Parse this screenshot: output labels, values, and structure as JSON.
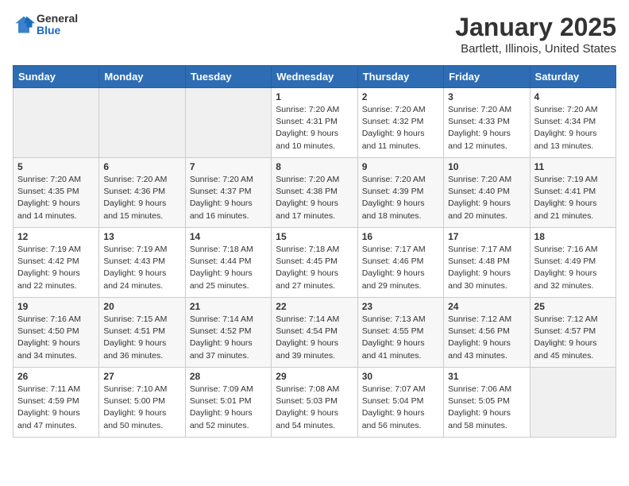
{
  "header": {
    "logo": {
      "general": "General",
      "blue": "Blue"
    },
    "title": "January 2025",
    "subtitle": "Bartlett, Illinois, United States"
  },
  "weekdays": [
    "Sunday",
    "Monday",
    "Tuesday",
    "Wednesday",
    "Thursday",
    "Friday",
    "Saturday"
  ],
  "weeks": [
    [
      {
        "day": "",
        "empty": true
      },
      {
        "day": "",
        "empty": true
      },
      {
        "day": "",
        "empty": true
      },
      {
        "day": "1",
        "sunrise": "7:20 AM",
        "sunset": "4:31 PM",
        "daylight": "9 hours and 10 minutes."
      },
      {
        "day": "2",
        "sunrise": "7:20 AM",
        "sunset": "4:32 PM",
        "daylight": "9 hours and 11 minutes."
      },
      {
        "day": "3",
        "sunrise": "7:20 AM",
        "sunset": "4:33 PM",
        "daylight": "9 hours and 12 minutes."
      },
      {
        "day": "4",
        "sunrise": "7:20 AM",
        "sunset": "4:34 PM",
        "daylight": "9 hours and 13 minutes."
      }
    ],
    [
      {
        "day": "5",
        "sunrise": "7:20 AM",
        "sunset": "4:35 PM",
        "daylight": "9 hours and 14 minutes."
      },
      {
        "day": "6",
        "sunrise": "7:20 AM",
        "sunset": "4:36 PM",
        "daylight": "9 hours and 15 minutes."
      },
      {
        "day": "7",
        "sunrise": "7:20 AM",
        "sunset": "4:37 PM",
        "daylight": "9 hours and 16 minutes."
      },
      {
        "day": "8",
        "sunrise": "7:20 AM",
        "sunset": "4:38 PM",
        "daylight": "9 hours and 17 minutes."
      },
      {
        "day": "9",
        "sunrise": "7:20 AM",
        "sunset": "4:39 PM",
        "daylight": "9 hours and 18 minutes."
      },
      {
        "day": "10",
        "sunrise": "7:20 AM",
        "sunset": "4:40 PM",
        "daylight": "9 hours and 20 minutes."
      },
      {
        "day": "11",
        "sunrise": "7:19 AM",
        "sunset": "4:41 PM",
        "daylight": "9 hours and 21 minutes."
      }
    ],
    [
      {
        "day": "12",
        "sunrise": "7:19 AM",
        "sunset": "4:42 PM",
        "daylight": "9 hours and 22 minutes."
      },
      {
        "day": "13",
        "sunrise": "7:19 AM",
        "sunset": "4:43 PM",
        "daylight": "9 hours and 24 minutes."
      },
      {
        "day": "14",
        "sunrise": "7:18 AM",
        "sunset": "4:44 PM",
        "daylight": "9 hours and 25 minutes."
      },
      {
        "day": "15",
        "sunrise": "7:18 AM",
        "sunset": "4:45 PM",
        "daylight": "9 hours and 27 minutes."
      },
      {
        "day": "16",
        "sunrise": "7:17 AM",
        "sunset": "4:46 PM",
        "daylight": "9 hours and 29 minutes."
      },
      {
        "day": "17",
        "sunrise": "7:17 AM",
        "sunset": "4:48 PM",
        "daylight": "9 hours and 30 minutes."
      },
      {
        "day": "18",
        "sunrise": "7:16 AM",
        "sunset": "4:49 PM",
        "daylight": "9 hours and 32 minutes."
      }
    ],
    [
      {
        "day": "19",
        "sunrise": "7:16 AM",
        "sunset": "4:50 PM",
        "daylight": "9 hours and 34 minutes."
      },
      {
        "day": "20",
        "sunrise": "7:15 AM",
        "sunset": "4:51 PM",
        "daylight": "9 hours and 36 minutes."
      },
      {
        "day": "21",
        "sunrise": "7:14 AM",
        "sunset": "4:52 PM",
        "daylight": "9 hours and 37 minutes."
      },
      {
        "day": "22",
        "sunrise": "7:14 AM",
        "sunset": "4:54 PM",
        "daylight": "9 hours and 39 minutes."
      },
      {
        "day": "23",
        "sunrise": "7:13 AM",
        "sunset": "4:55 PM",
        "daylight": "9 hours and 41 minutes."
      },
      {
        "day": "24",
        "sunrise": "7:12 AM",
        "sunset": "4:56 PM",
        "daylight": "9 hours and 43 minutes."
      },
      {
        "day": "25",
        "sunrise": "7:12 AM",
        "sunset": "4:57 PM",
        "daylight": "9 hours and 45 minutes."
      }
    ],
    [
      {
        "day": "26",
        "sunrise": "7:11 AM",
        "sunset": "4:59 PM",
        "daylight": "9 hours and 47 minutes."
      },
      {
        "day": "27",
        "sunrise": "7:10 AM",
        "sunset": "5:00 PM",
        "daylight": "9 hours and 50 minutes."
      },
      {
        "day": "28",
        "sunrise": "7:09 AM",
        "sunset": "5:01 PM",
        "daylight": "9 hours and 52 minutes."
      },
      {
        "day": "29",
        "sunrise": "7:08 AM",
        "sunset": "5:03 PM",
        "daylight": "9 hours and 54 minutes."
      },
      {
        "day": "30",
        "sunrise": "7:07 AM",
        "sunset": "5:04 PM",
        "daylight": "9 hours and 56 minutes."
      },
      {
        "day": "31",
        "sunrise": "7:06 AM",
        "sunset": "5:05 PM",
        "daylight": "9 hours and 58 minutes."
      },
      {
        "day": "",
        "empty": true
      }
    ]
  ],
  "labels": {
    "sunrise": "Sunrise:",
    "sunset": "Sunset:",
    "daylight": "Daylight:"
  }
}
